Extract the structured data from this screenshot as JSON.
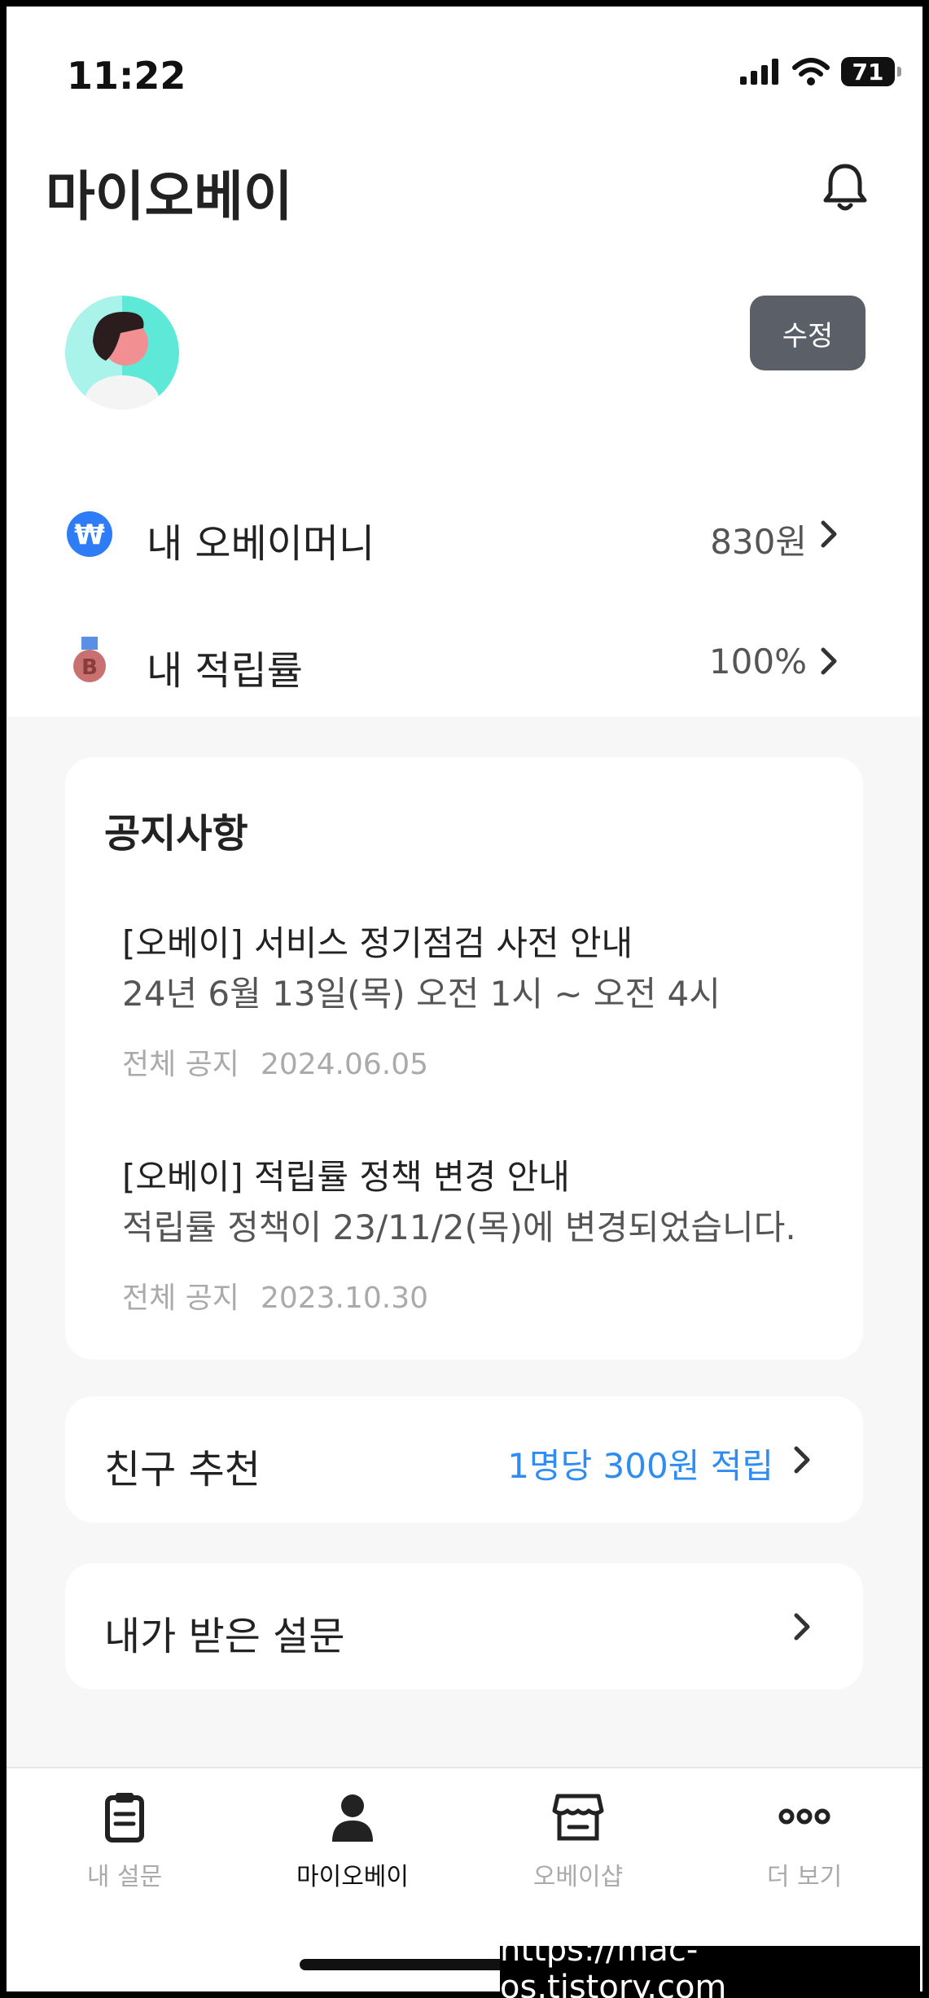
{
  "status": {
    "time": "11:22",
    "battery": "71"
  },
  "header": {
    "title": "마이오베이"
  },
  "profile": {
    "edit_label": "수정"
  },
  "menu": {
    "money": {
      "label": "내 오베이머니",
      "value": "830원"
    },
    "rate": {
      "label": "내 적립률",
      "value": "100%"
    }
  },
  "notices": {
    "heading": "공지사항",
    "items": [
      {
        "title": "[오베이] 서비스 정기점검 사전 안내",
        "desc": "24년 6월 13일(목) 오전 1시 ~ 오전 4시",
        "category": "전체 공지",
        "date": "2024.06.05"
      },
      {
        "title": "[오베이] 적립률 정책 변경 안내",
        "desc": "적립률 정책이 23/11/2(목)에 변경되었습니다.",
        "category": "전체 공지",
        "date": "2023.10.30"
      }
    ]
  },
  "referral": {
    "label": "친구 추천",
    "value": "1명당 300원 적립"
  },
  "survey": {
    "label": "내가 받은 설문"
  },
  "tabs": [
    {
      "label": "내 설문",
      "icon": "clipboard-icon"
    },
    {
      "label": "마이오베이",
      "icon": "person-icon",
      "active": true
    },
    {
      "label": "오베이샵",
      "icon": "store-icon"
    },
    {
      "label": "더 보기",
      "icon": "more-icon"
    }
  ],
  "colors": {
    "accent": "#2f8cf2",
    "edit_button": "#5b6068",
    "background": "#f7f7f7"
  },
  "watermark": "https://mac-os.tistory.com"
}
